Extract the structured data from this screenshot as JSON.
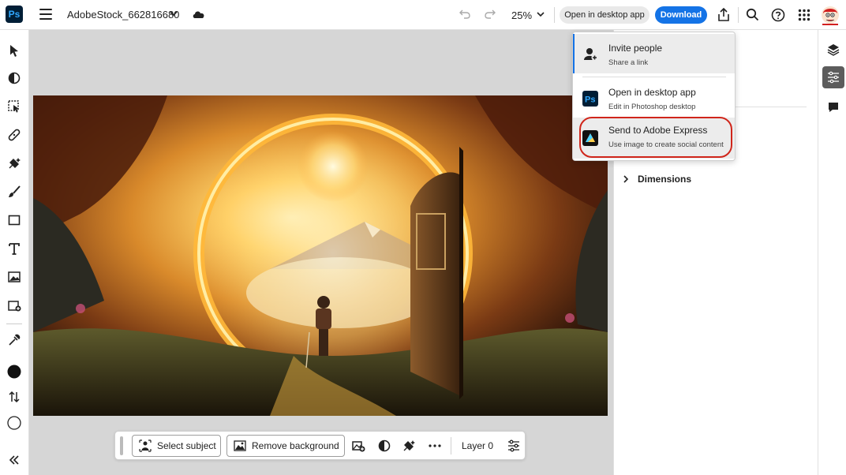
{
  "app": {
    "logo_text": "Ps"
  },
  "header": {
    "doc_title": "AdobeStock_662816680",
    "zoom": "25%",
    "open_desktop_label": "Open in desktop app",
    "download_label": "Download"
  },
  "share_menu": {
    "items": [
      {
        "title": "Invite people",
        "subtitle": "Share a link",
        "icon": "invite-people-icon"
      },
      {
        "title": "Open in desktop app",
        "subtitle": "Edit in Photoshop desktop",
        "icon": "photoshop-icon"
      },
      {
        "title": "Send to Adobe Express",
        "subtitle": "Use image to create social content",
        "icon": "adobe-express-icon"
      }
    ]
  },
  "properties_panel": {
    "dimensions_label": "Dimensions"
  },
  "taskbar": {
    "select_subject_label": "Select subject",
    "remove_background_label": "Remove background",
    "layer_label": "Layer 0"
  },
  "colors": {
    "accent_blue": "#1473e6",
    "highlight_ring": "#d0261b",
    "ps_logo_bg": "#001e36",
    "ps_logo_fg": "#31a8ff"
  }
}
